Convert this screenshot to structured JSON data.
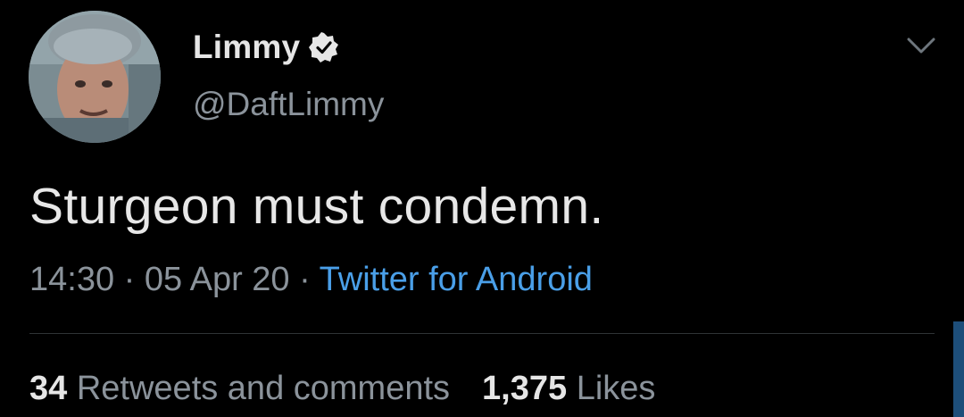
{
  "author": {
    "display_name": "Limmy",
    "handle": "@DaftLimmy",
    "verified_icon": "verified-badge-icon",
    "avatar_icon": "avatar-photo"
  },
  "tweet": {
    "text": "Sturgeon must condemn."
  },
  "meta": {
    "time": "14:30",
    "sep1": " · ",
    "date": "05 Apr 20",
    "sep2": " · ",
    "source": "Twitter for Android"
  },
  "stats": {
    "retweets_count": "34",
    "retweets_label": "Retweets and comments",
    "likes_count": "1,375",
    "likes_label": "Likes"
  },
  "menu_icon": "chevron-down-icon",
  "colors": {
    "background": "#000000",
    "link": "#4a9fe8",
    "muted": "#8b939b",
    "text": "#e7e7e7"
  }
}
